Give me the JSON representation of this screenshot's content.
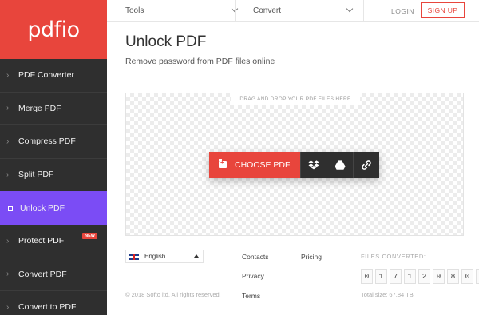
{
  "app": {
    "logo": "pdfio",
    "brand_color": "#e8453c",
    "active_color": "#7b4cf5"
  },
  "sidebar": {
    "items": [
      {
        "label": "PDF Converter",
        "icon": "chevron-right-icon"
      },
      {
        "label": "Merge PDF",
        "icon": "chevron-right-icon"
      },
      {
        "label": "Compress PDF",
        "icon": "chevron-right-icon"
      },
      {
        "label": "Split PDF",
        "icon": "chevron-right-icon"
      },
      {
        "label": "Unlock PDF",
        "icon": "square-icon",
        "active": true
      },
      {
        "label": "Protect PDF",
        "icon": "chevron-right-icon",
        "badge": "NEW"
      },
      {
        "label": "Convert PDF",
        "icon": "chevron-right-icon"
      },
      {
        "label": "Convert to PDF",
        "icon": "chevron-right-icon"
      }
    ]
  },
  "topbar": {
    "tools_label": "Tools",
    "convert_label": "Convert",
    "login_label": "LOGIN",
    "signup_label": "SIGN UP"
  },
  "main": {
    "title": "Unlock PDF",
    "subtitle": "Remove password from PDF files online",
    "dropzone_label": "DRAG AND DROP YOUR PDF FILES HERE",
    "choose_label": "CHOOSE PDF",
    "services": [
      "dropbox-icon",
      "google-drive-icon",
      "link-icon"
    ]
  },
  "footer": {
    "language": "English",
    "copyright": "© 2018 Softo ltd. All rights reserved.",
    "links": {
      "contacts": "Contacts",
      "privacy": "Privacy",
      "terms": "Terms",
      "pricing": "Pricing"
    },
    "files_converted_label": "FILES CONVERTED:",
    "counter": [
      "0",
      "1",
      "7",
      ",",
      "1",
      "2",
      "9",
      ",",
      "8",
      "0",
      "0"
    ],
    "total_size": "Total size: 67.84 TB"
  }
}
